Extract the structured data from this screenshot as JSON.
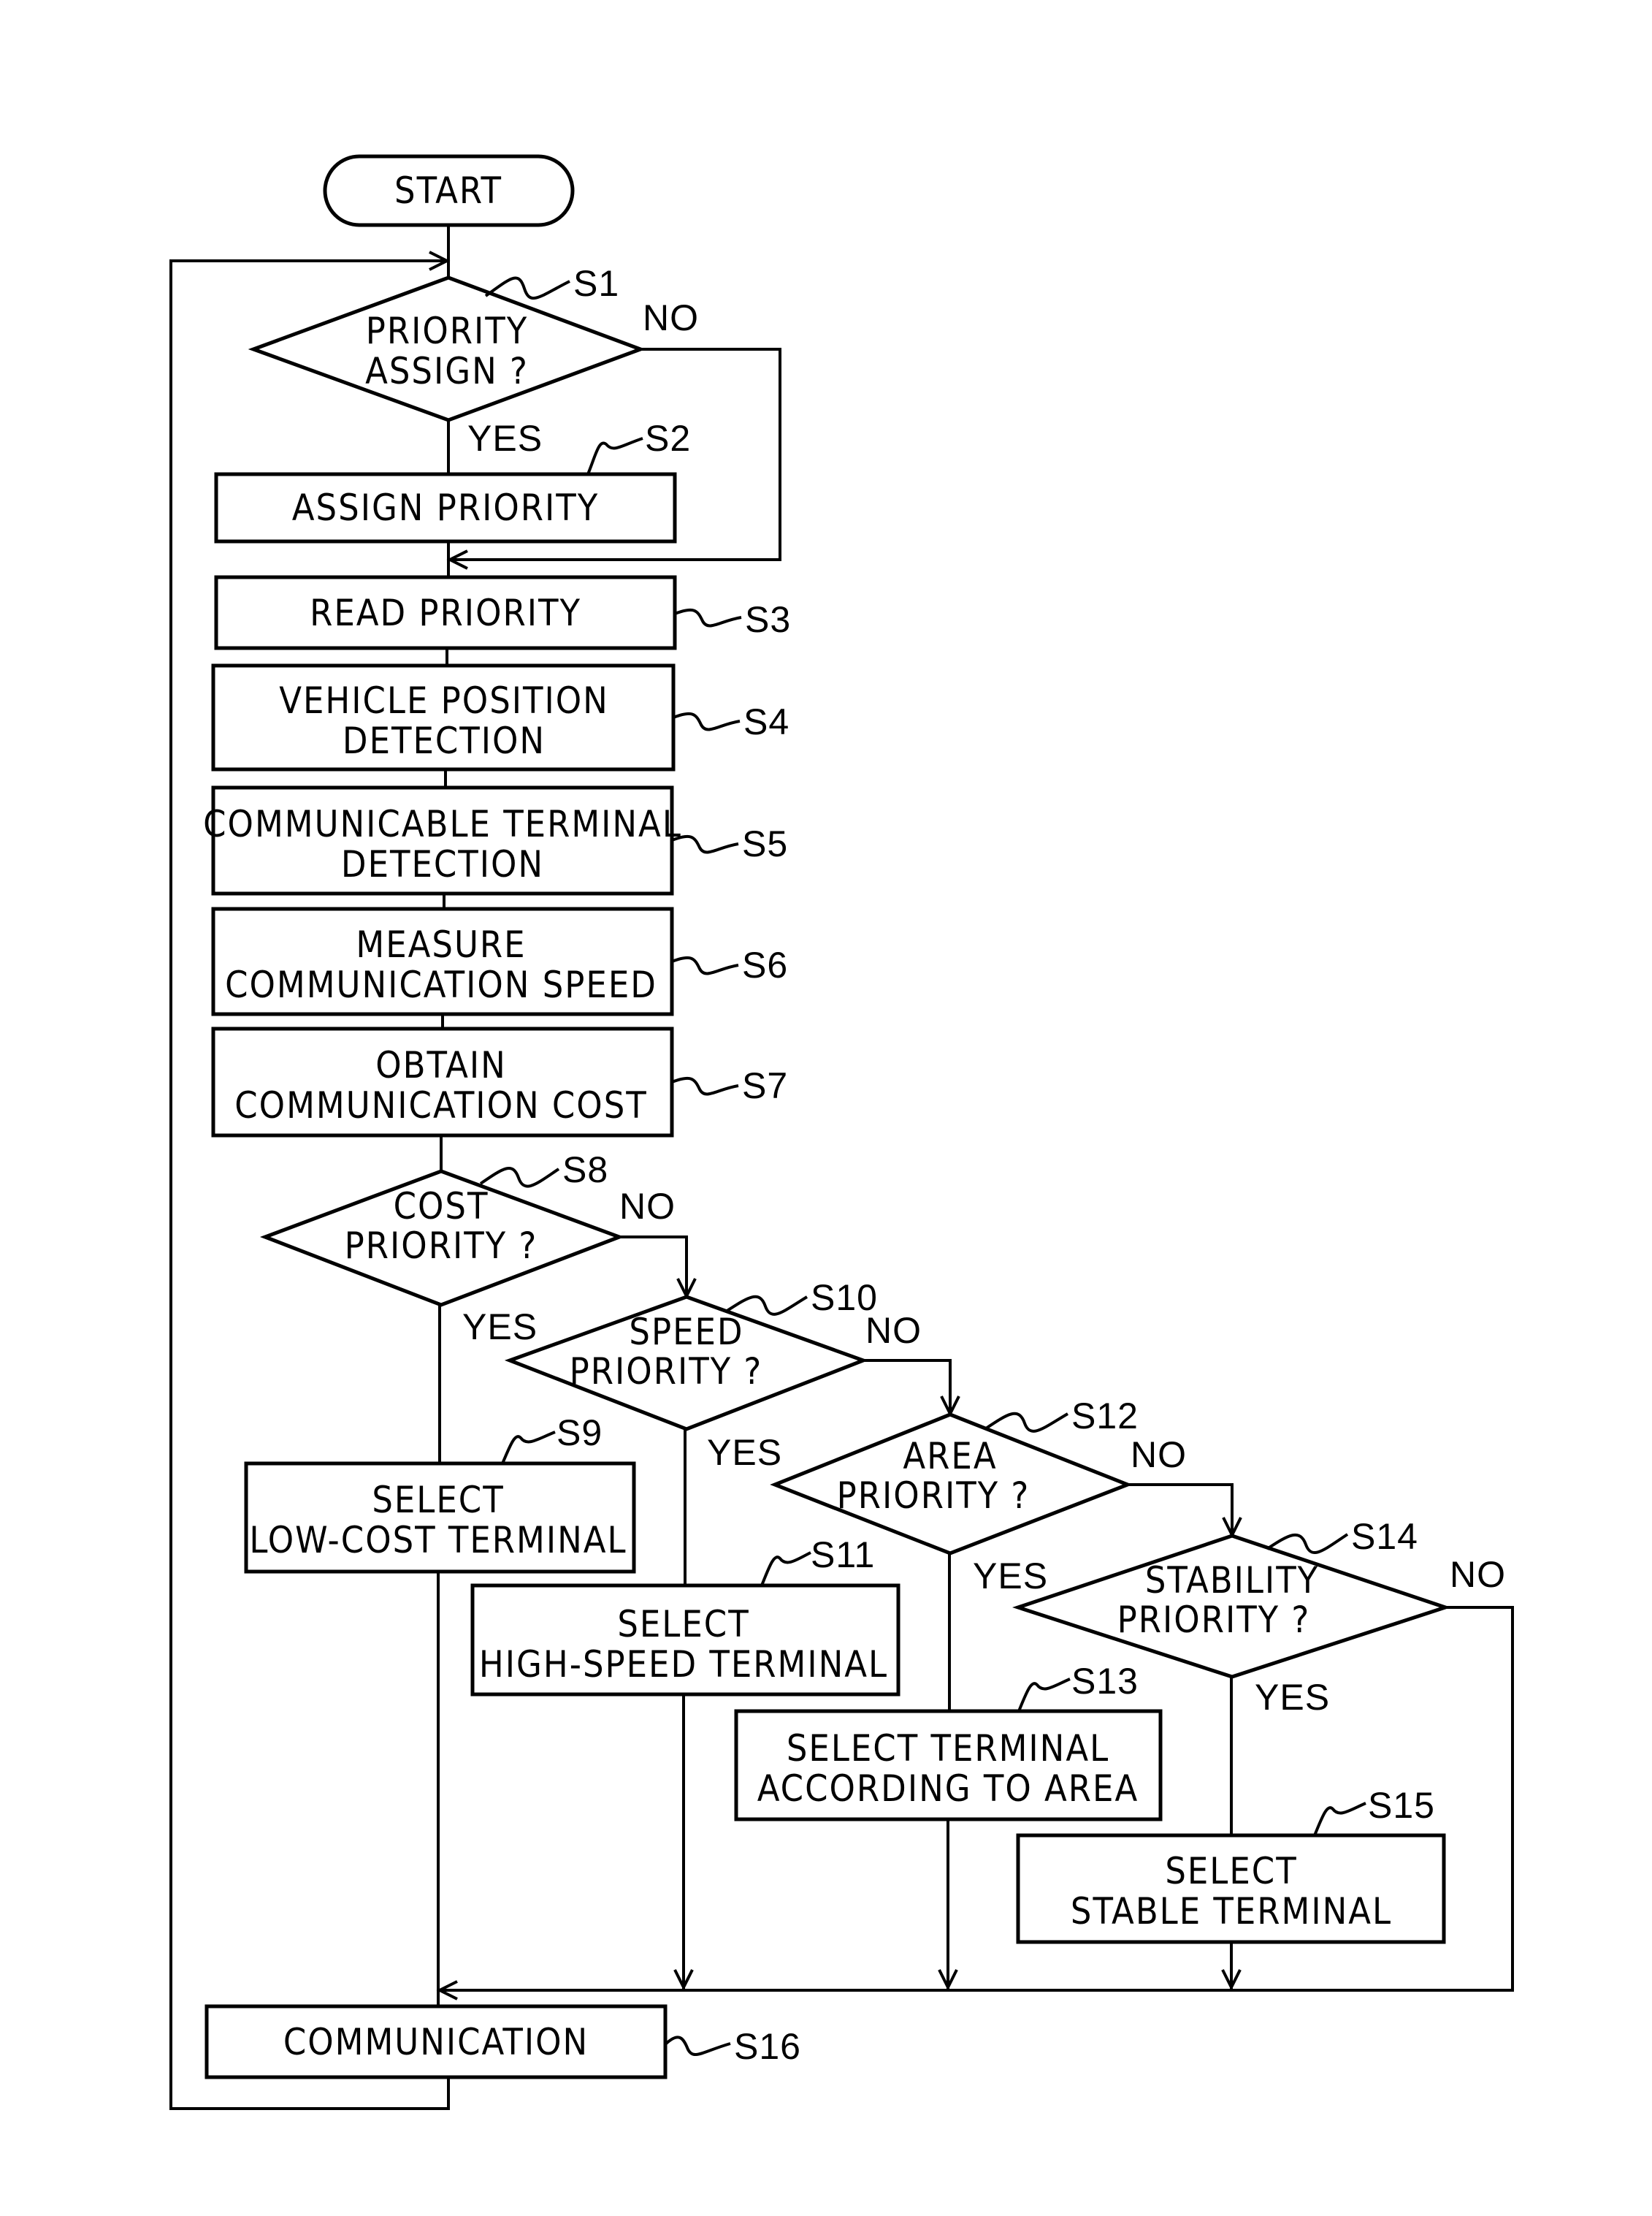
{
  "flowchart": {
    "start": "START",
    "steps": {
      "S1": {
        "id": "S1",
        "lines": [
          "PRIORITY",
          "ASSIGN ?"
        ],
        "type": "decision",
        "yes": "YES",
        "no": "NO"
      },
      "S2": {
        "id": "S2",
        "lines": [
          "ASSIGN PRIORITY"
        ],
        "type": "process"
      },
      "S3": {
        "id": "S3",
        "lines": [
          "READ PRIORITY"
        ],
        "type": "process"
      },
      "S4": {
        "id": "S4",
        "lines": [
          "VEHICLE POSITION",
          "DETECTION"
        ],
        "type": "process"
      },
      "S5": {
        "id": "S5",
        "lines": [
          "COMMUNICABLE TERMINAL",
          "DETECTION"
        ],
        "type": "process"
      },
      "S6": {
        "id": "S6",
        "lines": [
          "MEASURE",
          "COMMUNICATION SPEED"
        ],
        "type": "process"
      },
      "S7": {
        "id": "S7",
        "lines": [
          "OBTAIN",
          "COMMUNICATION COST"
        ],
        "type": "process"
      },
      "S8": {
        "id": "S8",
        "lines": [
          "COST",
          "PRIORITY ?"
        ],
        "type": "decision",
        "yes": "YES",
        "no": "NO"
      },
      "S9": {
        "id": "S9",
        "lines": [
          "SELECT",
          "LOW-COST TERMINAL"
        ],
        "type": "process"
      },
      "S10": {
        "id": "S10",
        "lines": [
          "SPEED",
          "PRIORITY ?"
        ],
        "type": "decision",
        "yes": "YES",
        "no": "NO"
      },
      "S11": {
        "id": "S11",
        "lines": [
          "SELECT",
          "HIGH-SPEED TERMINAL"
        ],
        "type": "process"
      },
      "S12": {
        "id": "S12",
        "lines": [
          "AREA",
          "PRIORITY ?"
        ],
        "type": "decision",
        "yes": "YES",
        "no": "NO"
      },
      "S13": {
        "id": "S13",
        "lines": [
          "SELECT TERMINAL",
          "ACCORDING TO AREA"
        ],
        "type": "process"
      },
      "S14": {
        "id": "S14",
        "lines": [
          "STABILITY",
          "PRIORITY ?"
        ],
        "type": "decision",
        "yes": "YES",
        "no": "NO"
      },
      "S15": {
        "id": "S15",
        "lines": [
          "SELECT",
          "STABLE TERMINAL"
        ],
        "type": "process"
      },
      "S16": {
        "id": "S16",
        "lines": [
          "COMMUNICATION"
        ],
        "type": "process"
      }
    }
  }
}
